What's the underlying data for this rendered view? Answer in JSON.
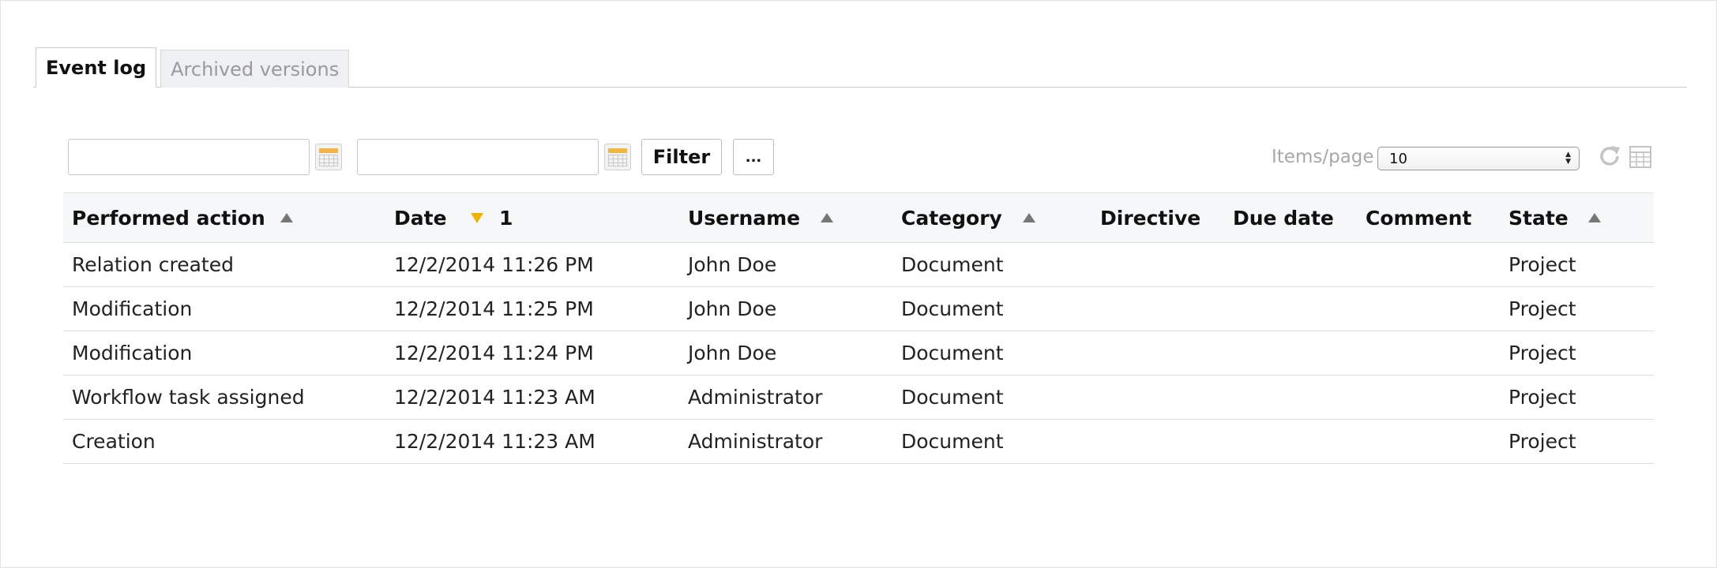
{
  "tabs": [
    {
      "label": "Event log",
      "active": true
    },
    {
      "label": "Archived versions",
      "active": false
    }
  ],
  "toolbar": {
    "date_from_value": "",
    "date_to_value": "",
    "filter_label": "Filter",
    "more_label": "...",
    "items_per_page_label": "Items/page",
    "items_per_page_value": "10",
    "refresh_icon": "refresh-icon",
    "export_icon": "spreadsheet-icon",
    "calendar_icon": "calendar-icon"
  },
  "table": {
    "headers": {
      "action": "Performed action",
      "date": "Date",
      "date_sort_priority": "1",
      "username": "Username",
      "category": "Category",
      "directive": "Directive",
      "due_date": "Due date",
      "comment": "Comment",
      "state": "State"
    },
    "rows": [
      {
        "action": "Relation created",
        "date": "12/2/2014 11:26 PM",
        "username": "John Doe",
        "category": "Document",
        "directive": "",
        "due_date": "",
        "comment": "",
        "state": "Project"
      },
      {
        "action": "Modification",
        "date": "12/2/2014 11:25 PM",
        "username": "John Doe",
        "category": "Document",
        "directive": "",
        "due_date": "",
        "comment": "",
        "state": "Project"
      },
      {
        "action": "Modification",
        "date": "12/2/2014 11:24 PM",
        "username": "John Doe",
        "category": "Document",
        "directive": "",
        "due_date": "",
        "comment": "",
        "state": "Project"
      },
      {
        "action": "Workflow task assigned",
        "date": "12/2/2014 11:23 AM",
        "username": "Administrator",
        "category": "Document",
        "directive": "",
        "due_date": "",
        "comment": "",
        "state": "Project"
      },
      {
        "action": "Creation",
        "date": "12/2/2014 11:23 AM",
        "username": "Administrator",
        "category": "Document",
        "directive": "",
        "due_date": "",
        "comment": "",
        "state": "Project"
      }
    ]
  },
  "colors": {
    "sort_active": "#f2b300",
    "sort_inactive": "#777777",
    "calendar_accent": "#f0b545",
    "header_bg": "#f6f7f9"
  }
}
